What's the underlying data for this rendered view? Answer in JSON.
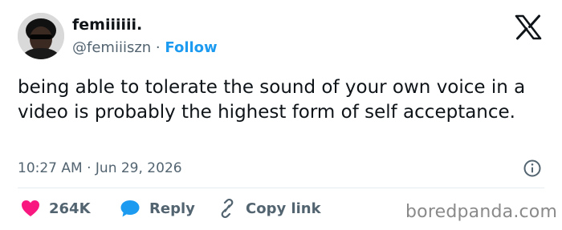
{
  "author": {
    "display_name": "femiiiiii.",
    "handle": "@femiiiszn",
    "separator": "·",
    "follow_label": "Follow"
  },
  "tweet": {
    "text": "being able to tolerate the sound of your own voice in a video is probably the highest form of self acceptance.",
    "timestamp": "10:27 AM · Jun 29, 2026"
  },
  "actions": {
    "likes_count": "264K",
    "reply_label": "Reply",
    "copy_link_label": "Copy link"
  },
  "icons": {
    "brand": "x-logo-icon",
    "info": "info-icon",
    "like": "heart-icon",
    "reply": "speech-bubble-icon",
    "copy": "link-icon"
  },
  "colors": {
    "accent": "#1d9bf0",
    "like": "#f91880",
    "text": "#0f1419",
    "muted": "#536471"
  },
  "watermark": "boredpanda.com"
}
